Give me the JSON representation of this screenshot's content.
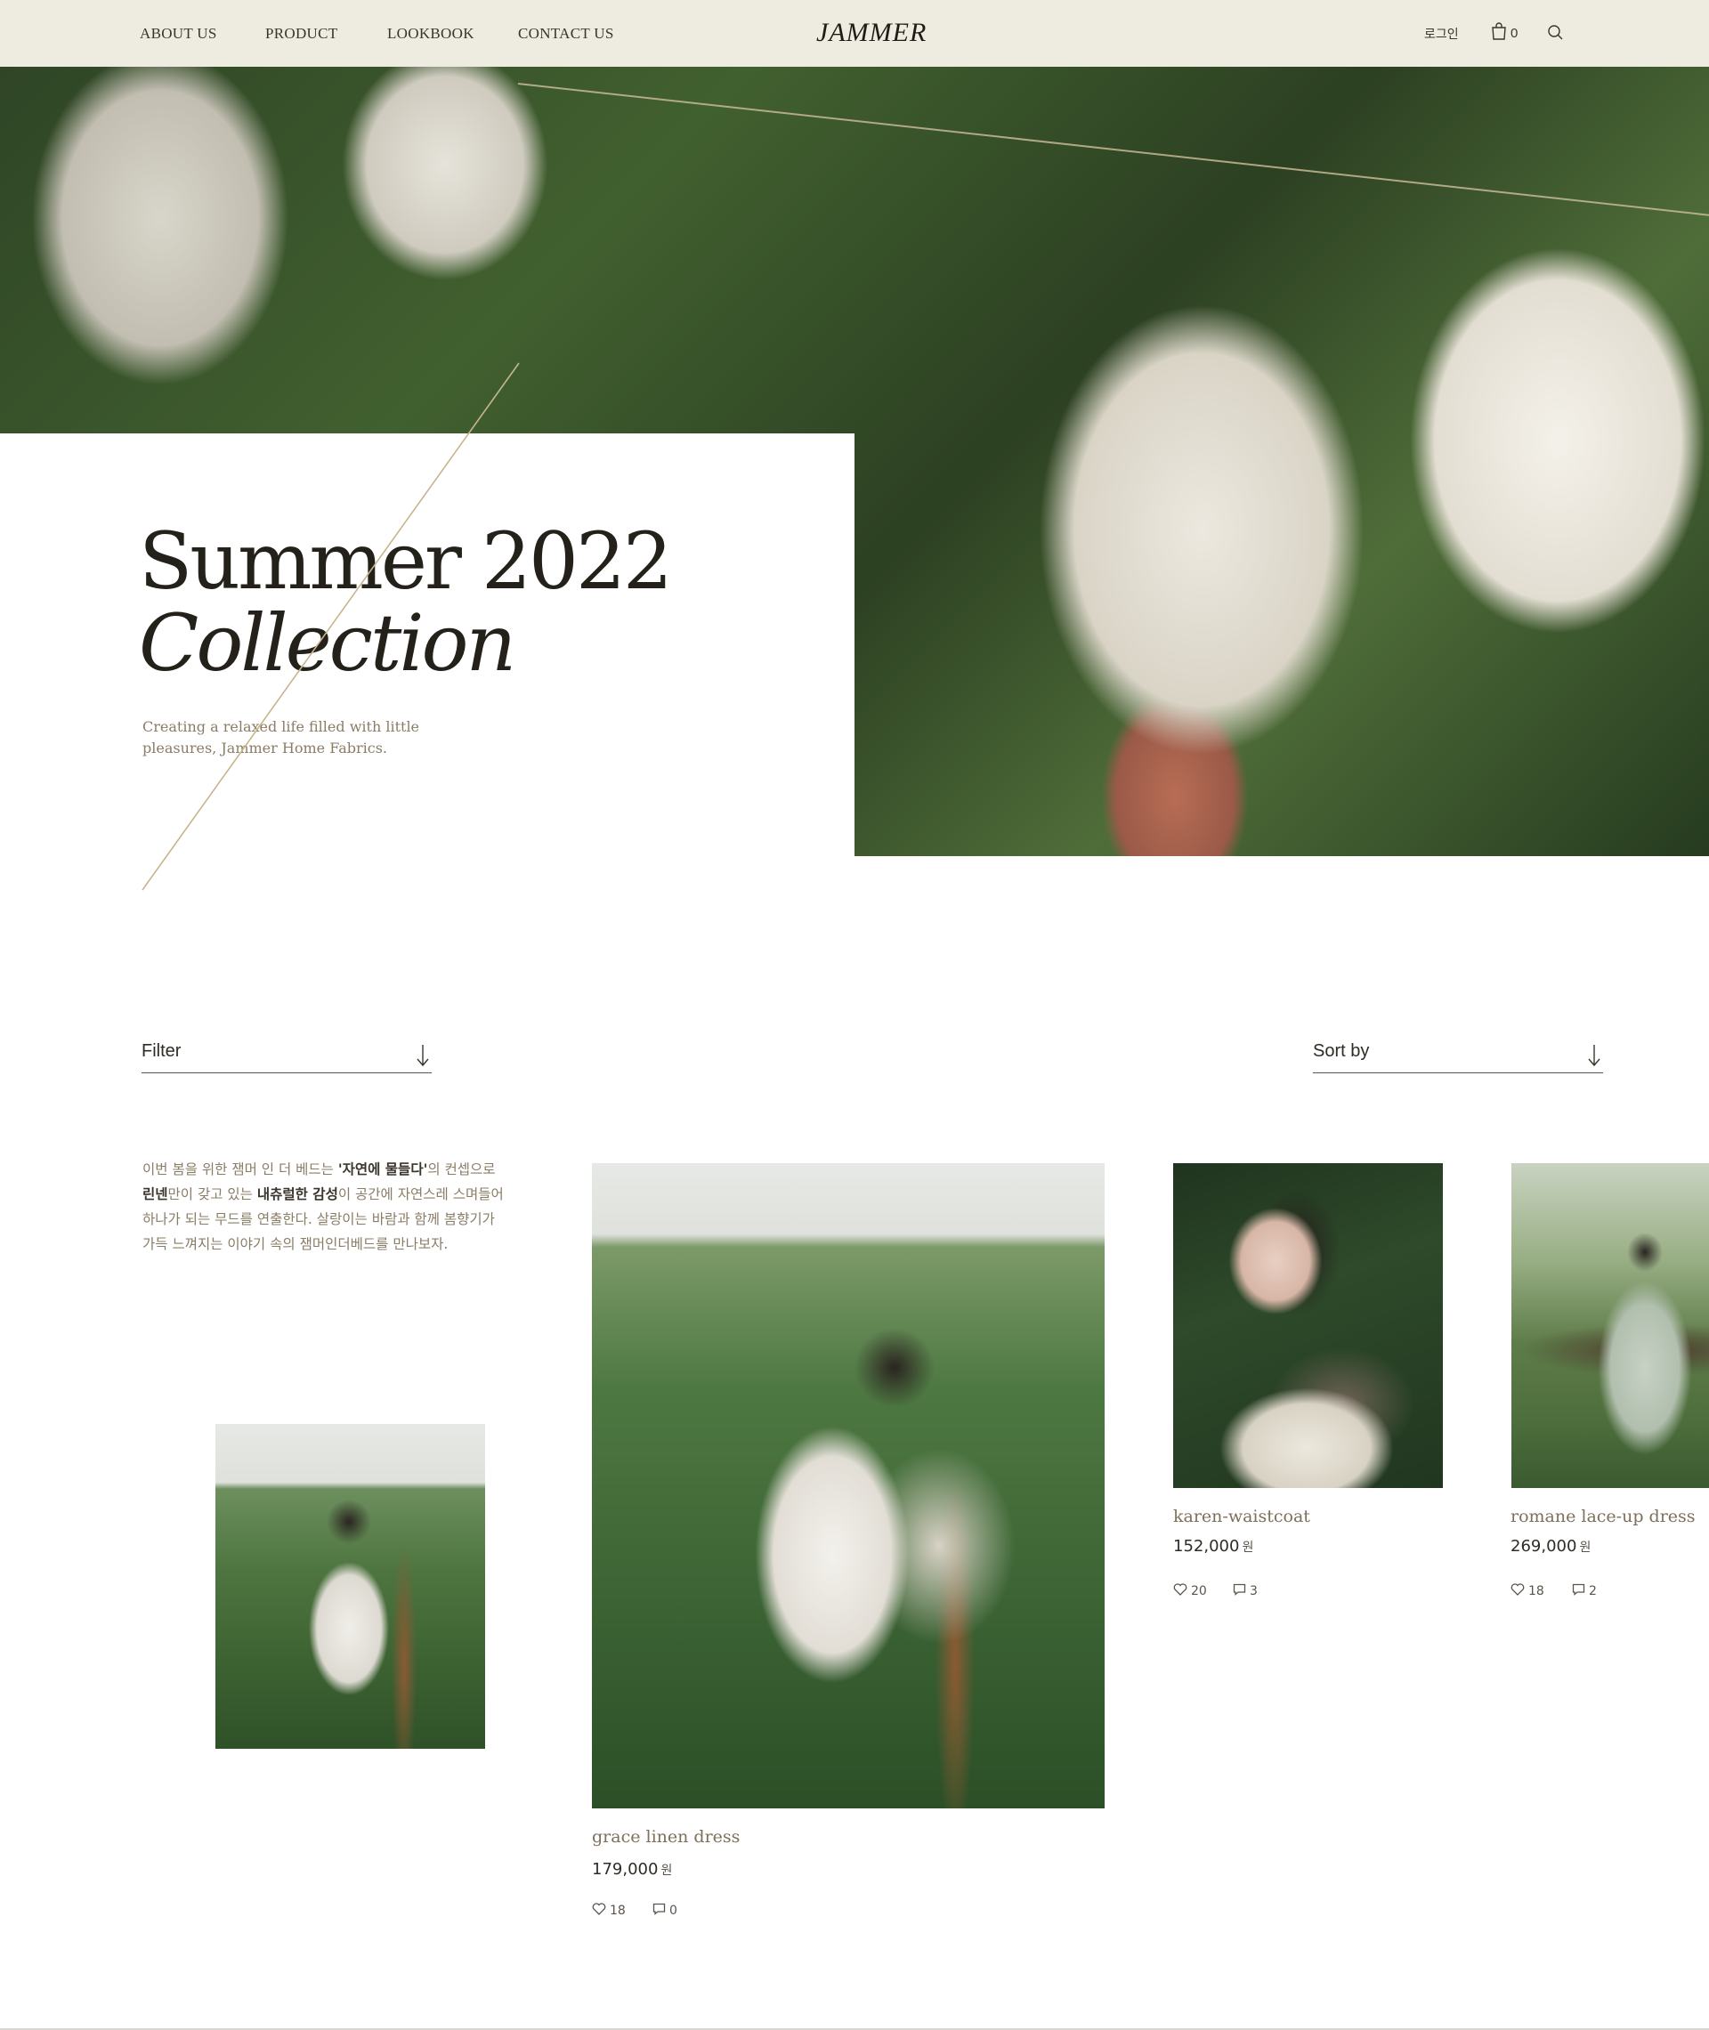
{
  "header": {
    "nav": [
      "ABOUT US",
      "PRODUCT",
      "LOOKBOOK",
      "CONTACT US"
    ],
    "brand": "JAMMER",
    "login": "로그인",
    "cart_count": "0"
  },
  "hero": {
    "title_line1": "Summer 2022",
    "title_line2": "Collection",
    "subtitle": "Creating a relaxed life filled with little pleasures, Jammer Home Fabrics."
  },
  "controls": {
    "filter_label": "Filter",
    "sort_label": "Sort by"
  },
  "description": {
    "line1_a": "이번 봄을 위한 잼머 인 더 베드는 ",
    "line1_bold": "'자연에 물들다'",
    "line1_b": "의 컨셉으로",
    "line2_bold1": "린넨",
    "line2_a": "만이 갖고 있는 ",
    "line2_bold2": "내츄럴한 감성",
    "line2_b": "이 공간에 자연스레 스며들어",
    "line3": "하나가 되는 무드를 연출한다. 살랑이는 바람과 함께 봄향기가",
    "line4": "가득 느껴지는 이야기 속의 잼머인더베드를 만나보자."
  },
  "products": [
    {
      "name": "grace linen dress",
      "price": "179,000",
      "currency": "원",
      "likes": "18",
      "comments": "0"
    },
    {
      "name": "karen-waistcoat",
      "price": "152,000",
      "currency": "원",
      "likes": "20",
      "comments": "3"
    },
    {
      "name": "romane lace-up dress",
      "price": "269,000",
      "currency": "원",
      "likes": "18",
      "comments": "2"
    }
  ],
  "colors": {
    "header_bg": "#eeebe0",
    "accent_line": "#c8b996",
    "muted_text": "#8a7d66"
  }
}
